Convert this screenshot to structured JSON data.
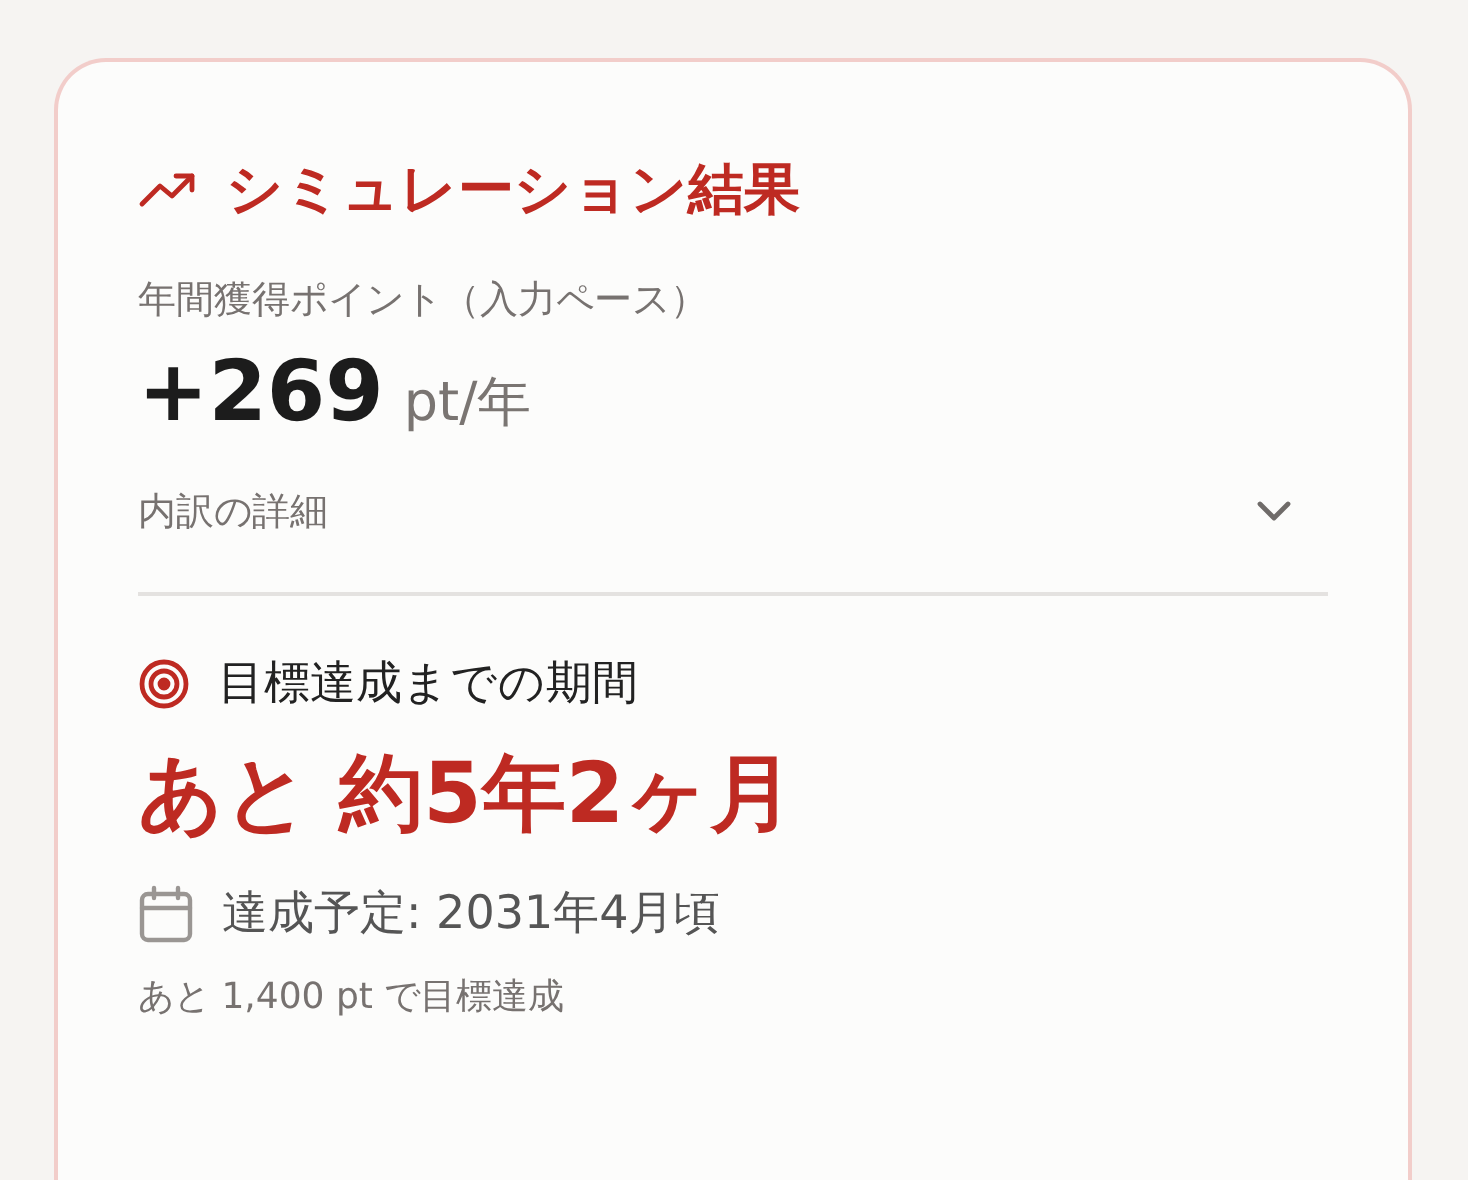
{
  "card": {
    "title": "シミュレーション結果",
    "annual": {
      "label": "年間獲得ポイント（入力ペース）",
      "value": "+269",
      "unit": "pt/年"
    },
    "details": {
      "label": "内訳の詳細",
      "expanded": false
    },
    "goal": {
      "heading": "目標達成までの期間",
      "duration": "あと 約5年2ヶ月",
      "eta": "達成予定: 2031年4月頃",
      "remaining": "あと 1,400 pt で目標達成"
    }
  }
}
